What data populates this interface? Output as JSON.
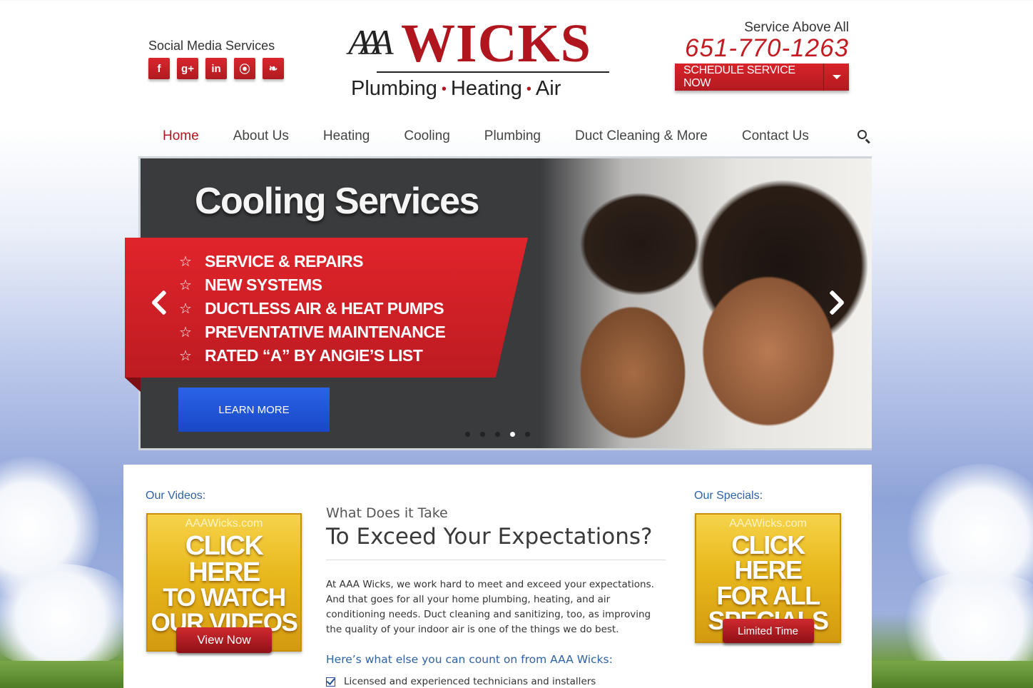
{
  "header": {
    "social_label": "Social Media Services",
    "social_icons": [
      {
        "name": "facebook-icon",
        "glyph": "f"
      },
      {
        "name": "google-plus-icon",
        "glyph": "g+"
      },
      {
        "name": "linkedin-icon",
        "glyph": "in"
      },
      {
        "name": "rss-icon",
        "glyph": "⦿"
      },
      {
        "name": "twitter-icon",
        "glyph": "❧"
      }
    ],
    "logo": {
      "aaa": "AAA",
      "wicks": "WICKS",
      "tagline_parts": [
        "Plumbing",
        "Heating",
        "Air"
      ],
      "dot": "•"
    },
    "motto": "Service Above All",
    "phone": "651-770-1263",
    "schedule_label": "SCHEDULE SERVICE NOW"
  },
  "nav": {
    "items": [
      "Home",
      "About Us",
      "Heating",
      "Cooling",
      "Plumbing",
      "Duct Cleaning & More",
      "Contact Us"
    ],
    "active": "Home"
  },
  "slider": {
    "title": "Cooling Services",
    "star": "☆",
    "features": [
      "SERVICE & REPAIRS",
      "NEW SYSTEMS",
      "DUCTLESS AIR & HEAT PUMPS",
      "PREVENTATIVE MAINTENANCE",
      "RATED “A” BY ANGIE’S LIST"
    ],
    "cta": "LEARN MORE",
    "slide_count": 5,
    "active_slide": 4
  },
  "videos": {
    "heading": "Our Videos:",
    "site": "AAAWicks.com",
    "line1": "CLICK HERE",
    "line2": "TO  WATCH",
    "line3": "OUR VIDEOS",
    "button": "View Now"
  },
  "main": {
    "pre_title": "What Does it Take",
    "title": "To Exceed Your Expectations?",
    "body": "At AAA Wicks, we work hard to meet and exceed your expectations. And that goes for all your home plumbing, heating, and air conditioning needs. Duct cleaning and sanitizing, too, as improving the quality of your indoor air is one of the things we do best.",
    "subhead": "Here’s what else you can count on from AAA Wicks:",
    "checklist": [
      "Licensed and experienced technicians and installers"
    ]
  },
  "specials": {
    "heading": "Our Specials:",
    "site": "AAAWicks.com",
    "line1": "CLICK HERE",
    "line2": "FOR ALL",
    "line3": "SPECIALS",
    "button": "Limited Time"
  },
  "colors": {
    "brand_red": "#b0161e",
    "link_blue": "#2e62a6",
    "cta_blue": "#1947c7"
  }
}
